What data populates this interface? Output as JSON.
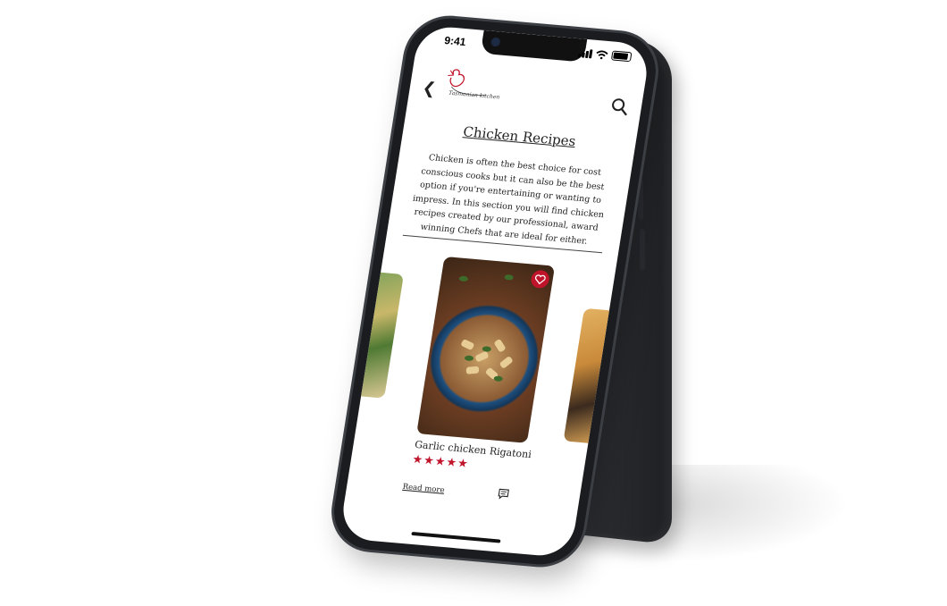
{
  "status_bar": {
    "time": "9:41"
  },
  "header": {
    "logo_text": "Tasmanian kitchen"
  },
  "page": {
    "title": "Chicken Recipes",
    "intro": "Chicken is often the best choice for cost conscious cooks but it can also be the best option if you're entertaining or wanting to impress. In this section you will find chicken recipes created by our professional, award winning Chefs that are ideal for either."
  },
  "carousel": {
    "featured": {
      "name": "Garlic chicken Rigatoni",
      "stars": "★★★★★",
      "rating": 5,
      "read_more": "Read more"
    }
  },
  "icons": [
    "chevron-left-icon",
    "search-icon",
    "heart-icon",
    "comment-icon",
    "signal-icon",
    "wifi-icon",
    "battery-icon"
  ],
  "colors": {
    "accent": "#c0142a",
    "text": "#222222",
    "background": "#ffffff"
  }
}
